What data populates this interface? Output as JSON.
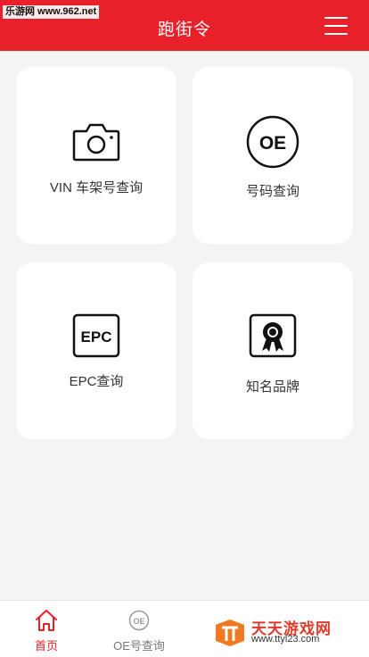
{
  "watermark_top": "乐游网 www.962.net",
  "header": {
    "title": "跑街令"
  },
  "cards": [
    {
      "label": "VIN 车架号查询",
      "icon": "camera-icon"
    },
    {
      "label": "号码查询",
      "icon": "oe-icon"
    },
    {
      "label": "EPC查询",
      "icon": "epc-icon"
    },
    {
      "label": "知名品牌",
      "icon": "award-badge-icon"
    }
  ],
  "icons": {
    "oe_text": "OE",
    "epc_text": "EPC"
  },
  "tabbar": {
    "tabs": [
      {
        "label": "首页",
        "icon": "home-icon",
        "active": true
      },
      {
        "label": "OE号查询",
        "icon": "oe-tab-icon",
        "active": false
      }
    ]
  },
  "watermark_brand": {
    "name": "天天游戏网",
    "url": "www.ttyl23.com"
  },
  "colors": {
    "accent": "#e8202a",
    "tab_inactive": "#999999",
    "background": "#f4f4f4"
  }
}
